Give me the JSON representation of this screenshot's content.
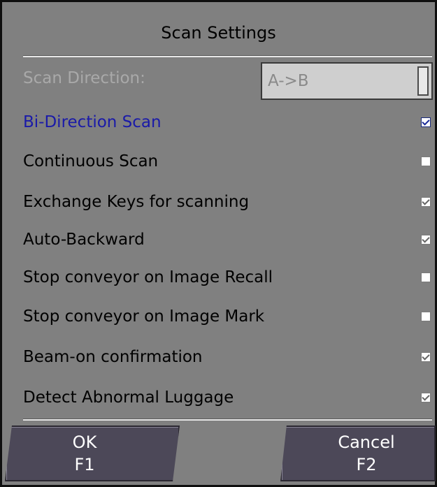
{
  "dialog": {
    "title": "Scan Settings",
    "scan_direction": {
      "label": "Scan Direction:",
      "value": "A->B"
    },
    "options": [
      {
        "label": "Bi-Direction Scan",
        "checked": true
      },
      {
        "label": "Continuous Scan",
        "checked": false
      },
      {
        "label": "Exchange Keys for scanning",
        "checked": true
      },
      {
        "label": "Auto-Backward",
        "checked": true
      },
      {
        "label": "Stop conveyor on Image Recall",
        "checked": false
      },
      {
        "label": "Stop conveyor on Image Mark",
        "checked": false
      },
      {
        "label": "Beam-on confirmation",
        "checked": true
      },
      {
        "label": "Detect Abnormal Luggage",
        "checked": true
      }
    ],
    "buttons": {
      "ok_label": "OK",
      "ok_key": "F1",
      "cancel_label": "Cancel",
      "cancel_key": "F2"
    }
  },
  "colors": {
    "background": "#808080",
    "highlight_text": "#1a1aa8",
    "disabled_text": "#a9a9a9",
    "button_bg": "#4c4858"
  }
}
